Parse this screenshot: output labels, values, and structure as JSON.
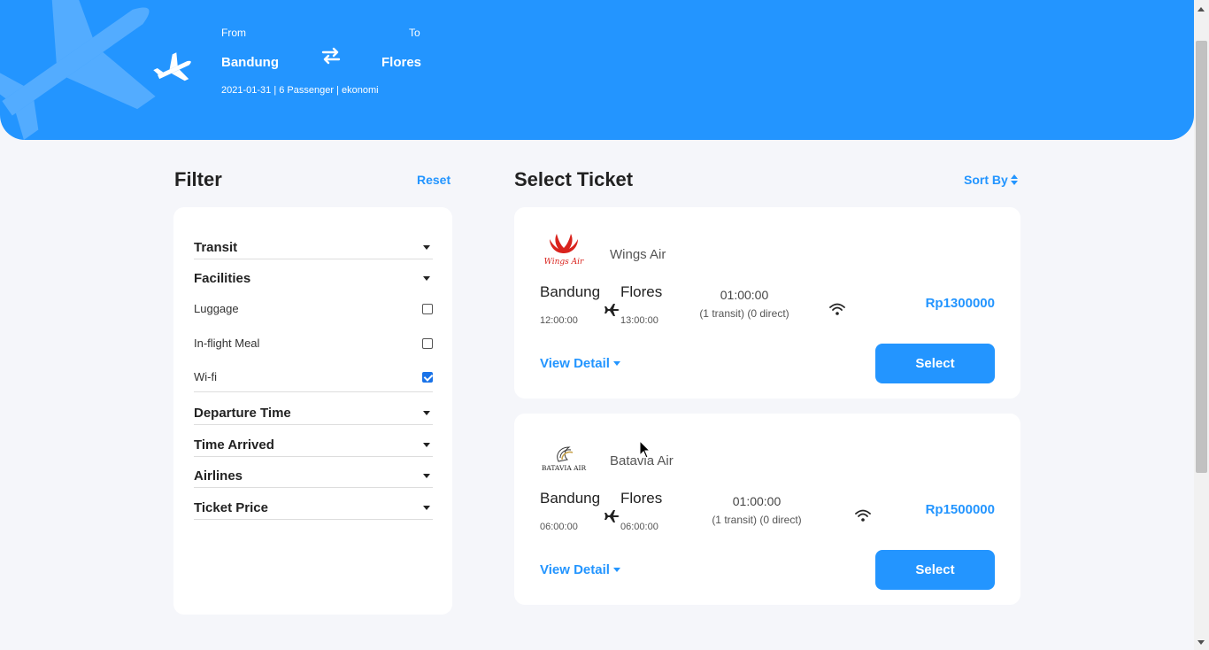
{
  "header": {
    "from_label": "From",
    "to_label": "To",
    "from_city": "Bandung",
    "to_city": "Flores",
    "trip_info": "2021-01-31 | 6 Passenger | ekonomi",
    "icons": [
      "plane-icon",
      "swap-arrows-icon"
    ],
    "background_color": "#2395ff"
  },
  "filter": {
    "title": "Filter",
    "reset_label": "Reset",
    "sections": {
      "transit": "Transit",
      "facilities": "Facilities",
      "departure_time": "Departure Time",
      "time_arrived": "Time Arrived",
      "airlines": "Airlines",
      "ticket_price": "Ticket Price"
    },
    "facility_options": [
      {
        "label": "Luggage",
        "checked": false
      },
      {
        "label": "In-flight Meal",
        "checked": false
      },
      {
        "label": "Wi-fi",
        "checked": true
      }
    ]
  },
  "tickets_section": {
    "title": "Select Ticket",
    "sort_label": "Sort By"
  },
  "tickets": [
    {
      "airline": "Wings Air",
      "logo_text": "Wings Air",
      "from": "Bandung",
      "to": "Flores",
      "departure": "12:00:00",
      "arrival": "13:00:00",
      "duration": "01:00:00",
      "transit": "(1 transit) (0 direct)",
      "price": "Rp1300000",
      "detail_label": "View Detail",
      "select_label": "Select"
    },
    {
      "airline": "Batavia Air",
      "logo_text": "BATAVIA AIR",
      "from": "Bandung",
      "to": "Flores",
      "departure": "06:00:00",
      "arrival": "06:00:00",
      "duration": "01:00:00",
      "transit": "(1 transit) (0 direct)",
      "price": "Rp1500000",
      "detail_label": "View Detail",
      "select_label": "Select"
    }
  ],
  "accent_color": "#2395ff"
}
